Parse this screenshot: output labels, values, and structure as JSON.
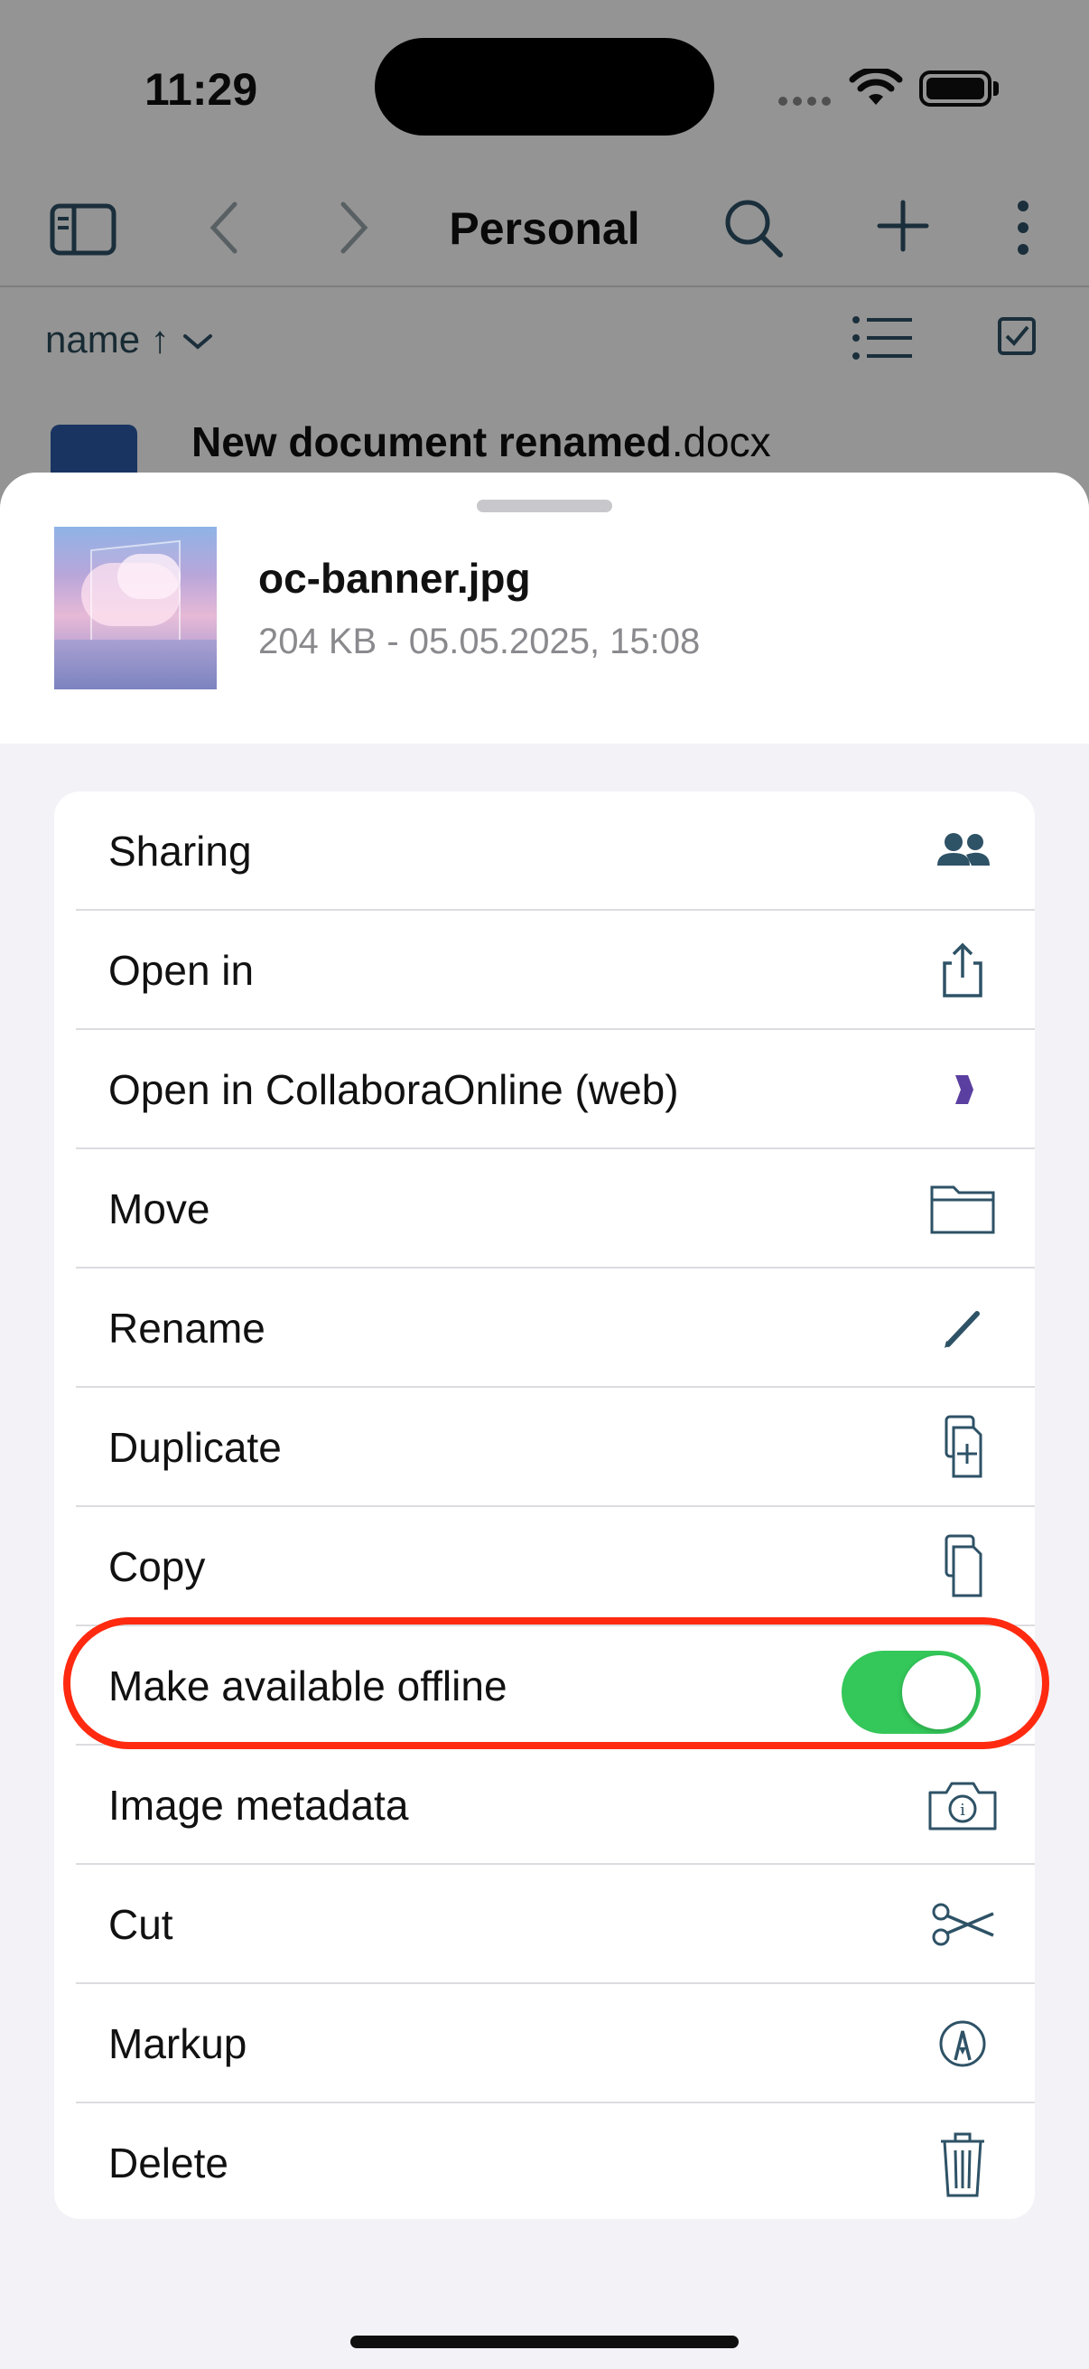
{
  "status": {
    "time": "11:29"
  },
  "nav": {
    "title": "Personal",
    "icons": [
      "sidebar-icon",
      "back-chevron-icon",
      "forward-chevron-icon",
      "search-icon",
      "plus-icon",
      "more-icon"
    ]
  },
  "sort": {
    "label": "name ↑"
  },
  "list": {
    "first_item_name": "New document renamed",
    "first_item_ext": ".docx"
  },
  "sheet": {
    "file_name": "oc-banner.jpg",
    "file_meta": "204 KB - 05.05.2025, 15:08",
    "items": [
      {
        "label": "Sharing",
        "icon": "people-icon"
      },
      {
        "label": "Open in",
        "icon": "share-icon"
      },
      {
        "label": "Open in CollaboraOnline (web)",
        "icon": "collabora-icon"
      },
      {
        "label": "Move",
        "icon": "folder-icon"
      },
      {
        "label": "Rename",
        "icon": "pencil-icon"
      },
      {
        "label": "Duplicate",
        "icon": "duplicate-icon"
      },
      {
        "label": "Copy",
        "icon": "copy-icon"
      },
      {
        "label": "Make available offline",
        "icon": "toggle",
        "toggle_on": true
      },
      {
        "label": "Image metadata",
        "icon": "camera-info-icon"
      },
      {
        "label": "Cut",
        "icon": "scissors-icon"
      },
      {
        "label": "Markup",
        "icon": "markup-icon"
      },
      {
        "label": "Delete",
        "icon": "trash-icon"
      }
    ]
  },
  "colors": {
    "toggle_on": "#34c759",
    "highlight": "#ff2a10",
    "icon": "#2e5266"
  }
}
